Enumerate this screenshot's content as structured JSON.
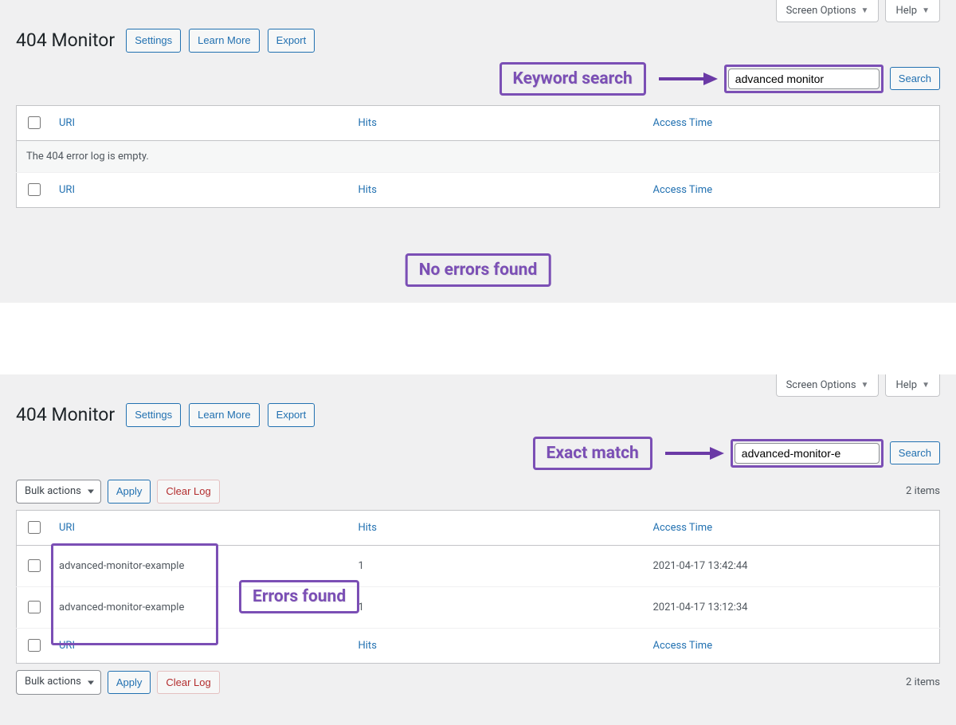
{
  "common": {
    "screen_options": "Screen Options",
    "help": "Help",
    "settings": "Settings",
    "learn_more": "Learn More",
    "export": "Export",
    "search": "Search",
    "bulk_actions": "Bulk actions",
    "apply": "Apply",
    "clear_log": "Clear Log",
    "cols": {
      "uri": "URI",
      "hits": "Hits",
      "access_time": "Access Time"
    }
  },
  "panel1": {
    "title": "404 Monitor",
    "search_value": "advanced monitor",
    "empty_msg": "The 404 error log is empty.",
    "callout_search": "Keyword search",
    "callout_noerrors": "No errors found"
  },
  "panel2": {
    "title": "404 Monitor",
    "search_value": "advanced-monitor-e",
    "items_count": "2 items",
    "callout_exact": "Exact match",
    "callout_errors": "Errors found",
    "rows": [
      {
        "uri": "advanced-monitor-example",
        "hits": "1",
        "time": "2021-04-17 13:42:44"
      },
      {
        "uri": "advanced-monitor-example",
        "hits": "1",
        "time": "2021-04-17 13:12:34"
      }
    ]
  }
}
